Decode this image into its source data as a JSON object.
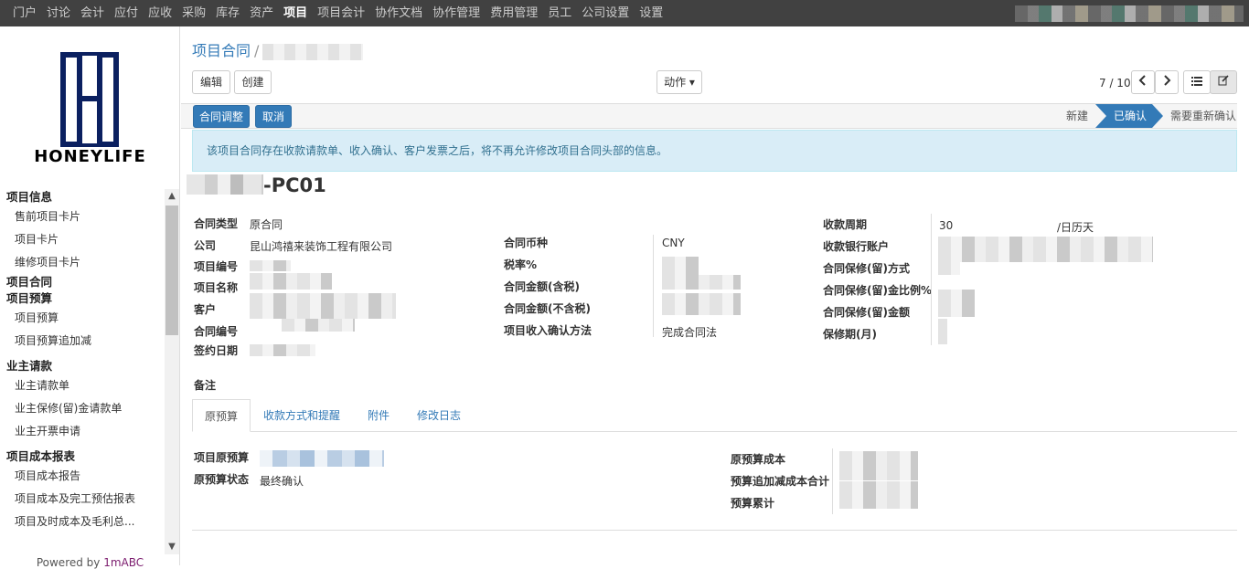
{
  "topnav": {
    "items": [
      "门户",
      "讨论",
      "会计",
      "应付",
      "应收",
      "采购",
      "库存",
      "资产",
      "项目",
      "项目会计",
      "协作文档",
      "协作管理",
      "费用管理",
      "员工",
      "公司设置",
      "设置"
    ],
    "active_index": 8
  },
  "sidebar": {
    "logo_text": "HONEYLIFE",
    "sections": [
      {
        "title": "项目信息",
        "items": [
          "售前项目卡片",
          "项目卡片",
          "维修项目卡片"
        ]
      },
      {
        "title": "项目合同",
        "items": []
      },
      {
        "title": "项目预算",
        "items": [
          "项目预算",
          "项目预算追加减"
        ]
      },
      {
        "title": "业主请款",
        "items": [
          "业主请款单",
          "业主保修(留)金请款单",
          "业主开票申请"
        ]
      },
      {
        "title": "项目成本报表",
        "items": [
          "项目成本报告",
          "项目成本及完工预估报表",
          "项目及时成本及毛利总..."
        ]
      }
    ],
    "powered_prefix": "Powered by ",
    "powered_brand": "1mABC"
  },
  "breadcrumb": {
    "root": "项目合同",
    "sep": "/"
  },
  "toolbar": {
    "edit": "编辑",
    "create": "创建",
    "action": "动作",
    "pager": "7 / 10",
    "prev_icon": "chevron-left-icon",
    "next_icon": "chevron-right-icon"
  },
  "statusbar": {
    "adjust": "合同调整",
    "cancel": "取消",
    "stages": [
      "新建",
      "已确认",
      "需要重新确认"
    ],
    "current_stage": 1
  },
  "alert": "该项目合同存在收款请款单、收入确认、客户发票之后，将不再允许修改项目合同头部的信息。",
  "record": {
    "title_suffix": "-PC01"
  },
  "form": {
    "col1": {
      "contract_type_label": "合同类型",
      "contract_type": "原合同",
      "company_label": "公司",
      "company": "昆山鸿禧来装饰工程有限公司",
      "project_no_label": "项目编号",
      "project_name_label": "项目名称",
      "customer_label": "客户",
      "contract_no_label": "合同编号",
      "sign_date_label": "签约日期"
    },
    "col2": {
      "currency_label": "合同币种",
      "currency": "CNY",
      "tax_rate_label": "税率%",
      "amount_tax_label": "合同金额(含税)",
      "amount_notax_label": "合同金额(不含税)",
      "revenue_method_label": "项目收入确认方法",
      "revenue_method": "完成合同法"
    },
    "col3": {
      "cycle_label": "收款周期",
      "cycle_value": "30",
      "cycle_unit": "/日历天",
      "bank_label": "收款银行账户",
      "warranty_method_label": "合同保修(留)方式",
      "warranty_ratio_label": "合同保修(留)金比例%",
      "warranty_amount_label": "合同保修(留)金额",
      "warranty_period_label": "保修期(月)"
    },
    "note_label": "备注"
  },
  "tabs": [
    "原预算",
    "收款方式和提醒",
    "附件",
    "修改日志"
  ],
  "budget": {
    "orig_budget_label": "项目原预算",
    "status_label": "原预算状态",
    "status": "最终确认",
    "orig_cost_label": "原预算成本",
    "adj_total_label": "预算追加减成本合计",
    "cumulative_label": "预算累计"
  }
}
